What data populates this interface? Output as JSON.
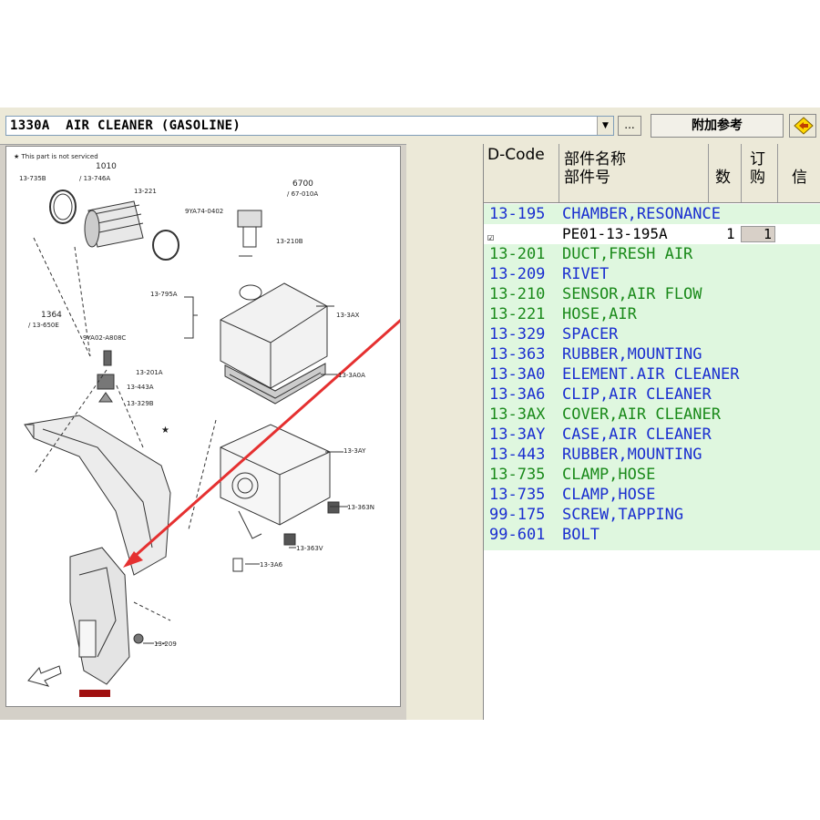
{
  "toolbar": {
    "combo_value": "1330A  AIR CLEANER (GASOLINE)",
    "dropdown_glyph": "▼",
    "dots_label": "...",
    "ref_button_label": "附加参考",
    "nav_icon": "diamond-arrow-icon"
  },
  "diagram": {
    "note": "★ This part is not serviced",
    "labels": {
      "l1": "13-735B",
      "l2": "1010",
      "l3": "/ 13-746A",
      "l4": "13-221",
      "l5": "6700",
      "l6": "/ 67-010A",
      "l7": "9YA74-0402",
      "l8": "13-210B",
      "l9": "13-795A",
      "l10": "13-3AX",
      "l11": "1364",
      "l12": "/ 13-650E",
      "l13": "9YA02-A808C",
      "l14": "13-201A",
      "l15": "13-443A",
      "l16": "13-329B",
      "l17": "13-3A0A",
      "l18": "13-3AY",
      "l19": "13-363N",
      "l20": "13-363V",
      "l21": "13-3A6",
      "l22": "13-209"
    }
  },
  "parts": {
    "headers": {
      "dcode": "D-Code",
      "name_line1": "部件名称",
      "name_line2": "部件号",
      "qty": "数",
      "order_line1": "订",
      "order_line2": "购",
      "info": "信"
    },
    "rows": [
      {
        "code": "13-195",
        "name": "CHAMBER,RESONANCE",
        "color": "blue"
      },
      {
        "code": "13-201",
        "name": "DUCT,FRESH AIR",
        "color": "green"
      },
      {
        "code": "13-209",
        "name": "RIVET",
        "color": "blue"
      },
      {
        "code": "13-210",
        "name": "SENSOR,AIR FLOW",
        "color": "green"
      },
      {
        "code": "13-221",
        "name": "HOSE,AIR",
        "color": "green"
      },
      {
        "code": "13-329",
        "name": "SPACER",
        "color": "blue"
      },
      {
        "code": "13-363",
        "name": "RUBBER,MOUNTING",
        "color": "blue"
      },
      {
        "code": "13-3A0",
        "name": "ELEMENT.AIR CLEANER",
        "color": "blue"
      },
      {
        "code": "13-3A6",
        "name": "CLIP,AIR CLEANER",
        "color": "blue"
      },
      {
        "code": "13-3AX",
        "name": "COVER,AIR CLEANER",
        "color": "green"
      },
      {
        "code": "13-3AY",
        "name": "CASE,AIR CLEANER",
        "color": "blue"
      },
      {
        "code": "13-443",
        "name": "RUBBER,MOUNTING",
        "color": "blue"
      },
      {
        "code": "13-735",
        "name": "CLAMP,HOSE",
        "color": "green"
      },
      {
        "code": "13-735",
        "name": "CLAMP,HOSE",
        "color": "blue"
      },
      {
        "code": "99-175",
        "name": "SCREW,TAPPING",
        "color": "blue"
      },
      {
        "code": "99-601",
        "name": "BOLT",
        "color": "blue"
      }
    ],
    "selected": {
      "checkbox": "☑",
      "part_number": "PE01-13-195A",
      "qty": "1",
      "order": "1"
    },
    "colors": {
      "blue": "#1a2ed0",
      "green": "#1a8a1a",
      "list_bg": "#dff7df"
    }
  }
}
